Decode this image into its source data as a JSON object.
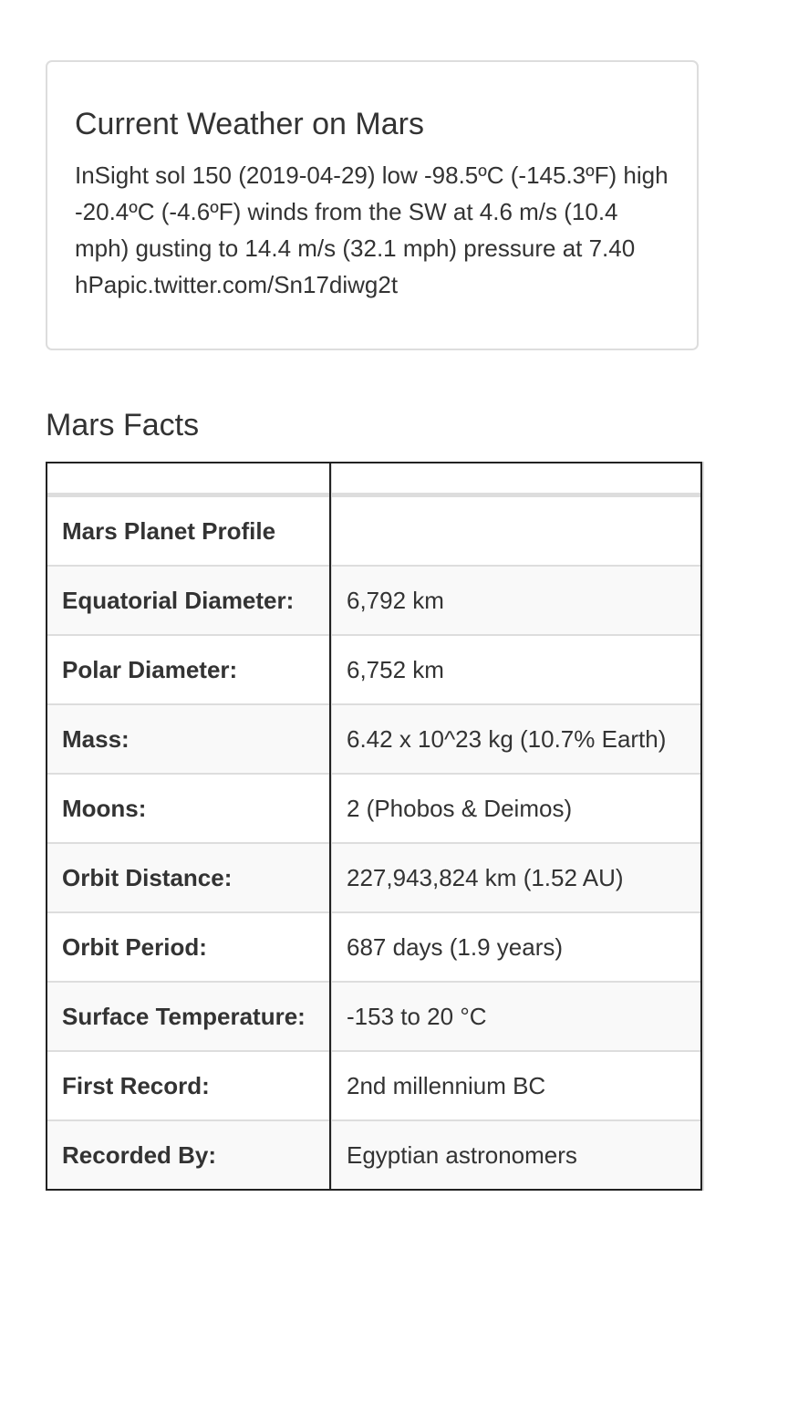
{
  "weather": {
    "title": "Current Weather on Mars",
    "text": "InSight sol 150 (2019-04-29) low -98.5ºC (-145.3ºF) high -20.4ºC (-4.6ºF) winds from the SW at 4.6 m/s (10.4 mph) gusting to 14.4 m/s (32.1 mph) pressure at 7.40 hPapic.twitter.com/Sn17diwg2t"
  },
  "facts": {
    "title": "Mars Facts",
    "header": [
      "",
      ""
    ],
    "rows": [
      {
        "label": "Mars Planet Profile",
        "value": ""
      },
      {
        "label": "Equatorial Diameter:",
        "value": "6,792 km"
      },
      {
        "label": "Polar Diameter:",
        "value": "6,752 km"
      },
      {
        "label": "Mass:",
        "value": "6.42 x 10^23 kg (10.7% Earth)"
      },
      {
        "label": "Moons:",
        "value": "2 (Phobos & Deimos)"
      },
      {
        "label": "Orbit Distance:",
        "value": "227,943,824 km (1.52 AU)"
      },
      {
        "label": "Orbit Period:",
        "value": "687 days (1.9 years)"
      },
      {
        "label": "Surface Temperature:",
        "value": "-153 to 20 °C"
      },
      {
        "label": "First Record:",
        "value": "2nd millennium BC"
      },
      {
        "label": "Recorded By:",
        "value": "Egyptian astronomers"
      }
    ]
  }
}
